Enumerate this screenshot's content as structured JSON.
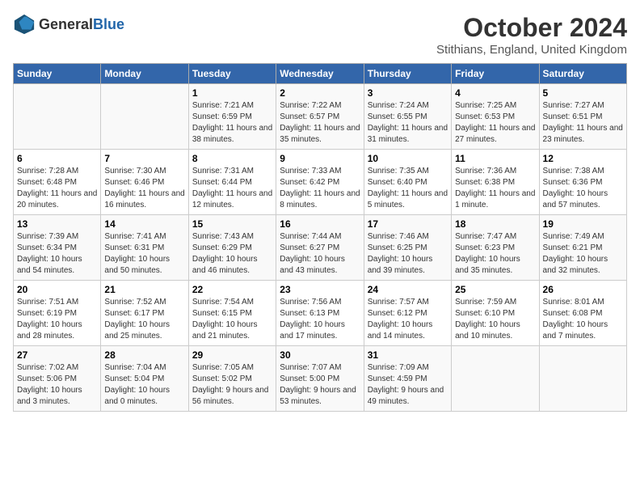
{
  "header": {
    "logo_general": "General",
    "logo_blue": "Blue",
    "month_title": "October 2024",
    "location": "Stithians, England, United Kingdom"
  },
  "days_of_week": [
    "Sunday",
    "Monday",
    "Tuesday",
    "Wednesday",
    "Thursday",
    "Friday",
    "Saturday"
  ],
  "weeks": [
    [
      {
        "day": "",
        "sunrise": "",
        "sunset": "",
        "daylight": ""
      },
      {
        "day": "",
        "sunrise": "",
        "sunset": "",
        "daylight": ""
      },
      {
        "day": "1",
        "sunrise": "Sunrise: 7:21 AM",
        "sunset": "Sunset: 6:59 PM",
        "daylight": "Daylight: 11 hours and 38 minutes."
      },
      {
        "day": "2",
        "sunrise": "Sunrise: 7:22 AM",
        "sunset": "Sunset: 6:57 PM",
        "daylight": "Daylight: 11 hours and 35 minutes."
      },
      {
        "day": "3",
        "sunrise": "Sunrise: 7:24 AM",
        "sunset": "Sunset: 6:55 PM",
        "daylight": "Daylight: 11 hours and 31 minutes."
      },
      {
        "day": "4",
        "sunrise": "Sunrise: 7:25 AM",
        "sunset": "Sunset: 6:53 PM",
        "daylight": "Daylight: 11 hours and 27 minutes."
      },
      {
        "day": "5",
        "sunrise": "Sunrise: 7:27 AM",
        "sunset": "Sunset: 6:51 PM",
        "daylight": "Daylight: 11 hours and 23 minutes."
      }
    ],
    [
      {
        "day": "6",
        "sunrise": "Sunrise: 7:28 AM",
        "sunset": "Sunset: 6:48 PM",
        "daylight": "Daylight: 11 hours and 20 minutes."
      },
      {
        "day": "7",
        "sunrise": "Sunrise: 7:30 AM",
        "sunset": "Sunset: 6:46 PM",
        "daylight": "Daylight: 11 hours and 16 minutes."
      },
      {
        "day": "8",
        "sunrise": "Sunrise: 7:31 AM",
        "sunset": "Sunset: 6:44 PM",
        "daylight": "Daylight: 11 hours and 12 minutes."
      },
      {
        "day": "9",
        "sunrise": "Sunrise: 7:33 AM",
        "sunset": "Sunset: 6:42 PM",
        "daylight": "Daylight: 11 hours and 8 minutes."
      },
      {
        "day": "10",
        "sunrise": "Sunrise: 7:35 AM",
        "sunset": "Sunset: 6:40 PM",
        "daylight": "Daylight: 11 hours and 5 minutes."
      },
      {
        "day": "11",
        "sunrise": "Sunrise: 7:36 AM",
        "sunset": "Sunset: 6:38 PM",
        "daylight": "Daylight: 11 hours and 1 minute."
      },
      {
        "day": "12",
        "sunrise": "Sunrise: 7:38 AM",
        "sunset": "Sunset: 6:36 PM",
        "daylight": "Daylight: 10 hours and 57 minutes."
      }
    ],
    [
      {
        "day": "13",
        "sunrise": "Sunrise: 7:39 AM",
        "sunset": "Sunset: 6:34 PM",
        "daylight": "Daylight: 10 hours and 54 minutes."
      },
      {
        "day": "14",
        "sunrise": "Sunrise: 7:41 AM",
        "sunset": "Sunset: 6:31 PM",
        "daylight": "Daylight: 10 hours and 50 minutes."
      },
      {
        "day": "15",
        "sunrise": "Sunrise: 7:43 AM",
        "sunset": "Sunset: 6:29 PM",
        "daylight": "Daylight: 10 hours and 46 minutes."
      },
      {
        "day": "16",
        "sunrise": "Sunrise: 7:44 AM",
        "sunset": "Sunset: 6:27 PM",
        "daylight": "Daylight: 10 hours and 43 minutes."
      },
      {
        "day": "17",
        "sunrise": "Sunrise: 7:46 AM",
        "sunset": "Sunset: 6:25 PM",
        "daylight": "Daylight: 10 hours and 39 minutes."
      },
      {
        "day": "18",
        "sunrise": "Sunrise: 7:47 AM",
        "sunset": "Sunset: 6:23 PM",
        "daylight": "Daylight: 10 hours and 35 minutes."
      },
      {
        "day": "19",
        "sunrise": "Sunrise: 7:49 AM",
        "sunset": "Sunset: 6:21 PM",
        "daylight": "Daylight: 10 hours and 32 minutes."
      }
    ],
    [
      {
        "day": "20",
        "sunrise": "Sunrise: 7:51 AM",
        "sunset": "Sunset: 6:19 PM",
        "daylight": "Daylight: 10 hours and 28 minutes."
      },
      {
        "day": "21",
        "sunrise": "Sunrise: 7:52 AM",
        "sunset": "Sunset: 6:17 PM",
        "daylight": "Daylight: 10 hours and 25 minutes."
      },
      {
        "day": "22",
        "sunrise": "Sunrise: 7:54 AM",
        "sunset": "Sunset: 6:15 PM",
        "daylight": "Daylight: 10 hours and 21 minutes."
      },
      {
        "day": "23",
        "sunrise": "Sunrise: 7:56 AM",
        "sunset": "Sunset: 6:13 PM",
        "daylight": "Daylight: 10 hours and 17 minutes."
      },
      {
        "day": "24",
        "sunrise": "Sunrise: 7:57 AM",
        "sunset": "Sunset: 6:12 PM",
        "daylight": "Daylight: 10 hours and 14 minutes."
      },
      {
        "day": "25",
        "sunrise": "Sunrise: 7:59 AM",
        "sunset": "Sunset: 6:10 PM",
        "daylight": "Daylight: 10 hours and 10 minutes."
      },
      {
        "day": "26",
        "sunrise": "Sunrise: 8:01 AM",
        "sunset": "Sunset: 6:08 PM",
        "daylight": "Daylight: 10 hours and 7 minutes."
      }
    ],
    [
      {
        "day": "27",
        "sunrise": "Sunrise: 7:02 AM",
        "sunset": "Sunset: 5:06 PM",
        "daylight": "Daylight: 10 hours and 3 minutes."
      },
      {
        "day": "28",
        "sunrise": "Sunrise: 7:04 AM",
        "sunset": "Sunset: 5:04 PM",
        "daylight": "Daylight: 10 hours and 0 minutes."
      },
      {
        "day": "29",
        "sunrise": "Sunrise: 7:05 AM",
        "sunset": "Sunset: 5:02 PM",
        "daylight": "Daylight: 9 hours and 56 minutes."
      },
      {
        "day": "30",
        "sunrise": "Sunrise: 7:07 AM",
        "sunset": "Sunset: 5:00 PM",
        "daylight": "Daylight: 9 hours and 53 minutes."
      },
      {
        "day": "31",
        "sunrise": "Sunrise: 7:09 AM",
        "sunset": "Sunset: 4:59 PM",
        "daylight": "Daylight: 9 hours and 49 minutes."
      },
      {
        "day": "",
        "sunrise": "",
        "sunset": "",
        "daylight": ""
      },
      {
        "day": "",
        "sunrise": "",
        "sunset": "",
        "daylight": ""
      }
    ]
  ]
}
